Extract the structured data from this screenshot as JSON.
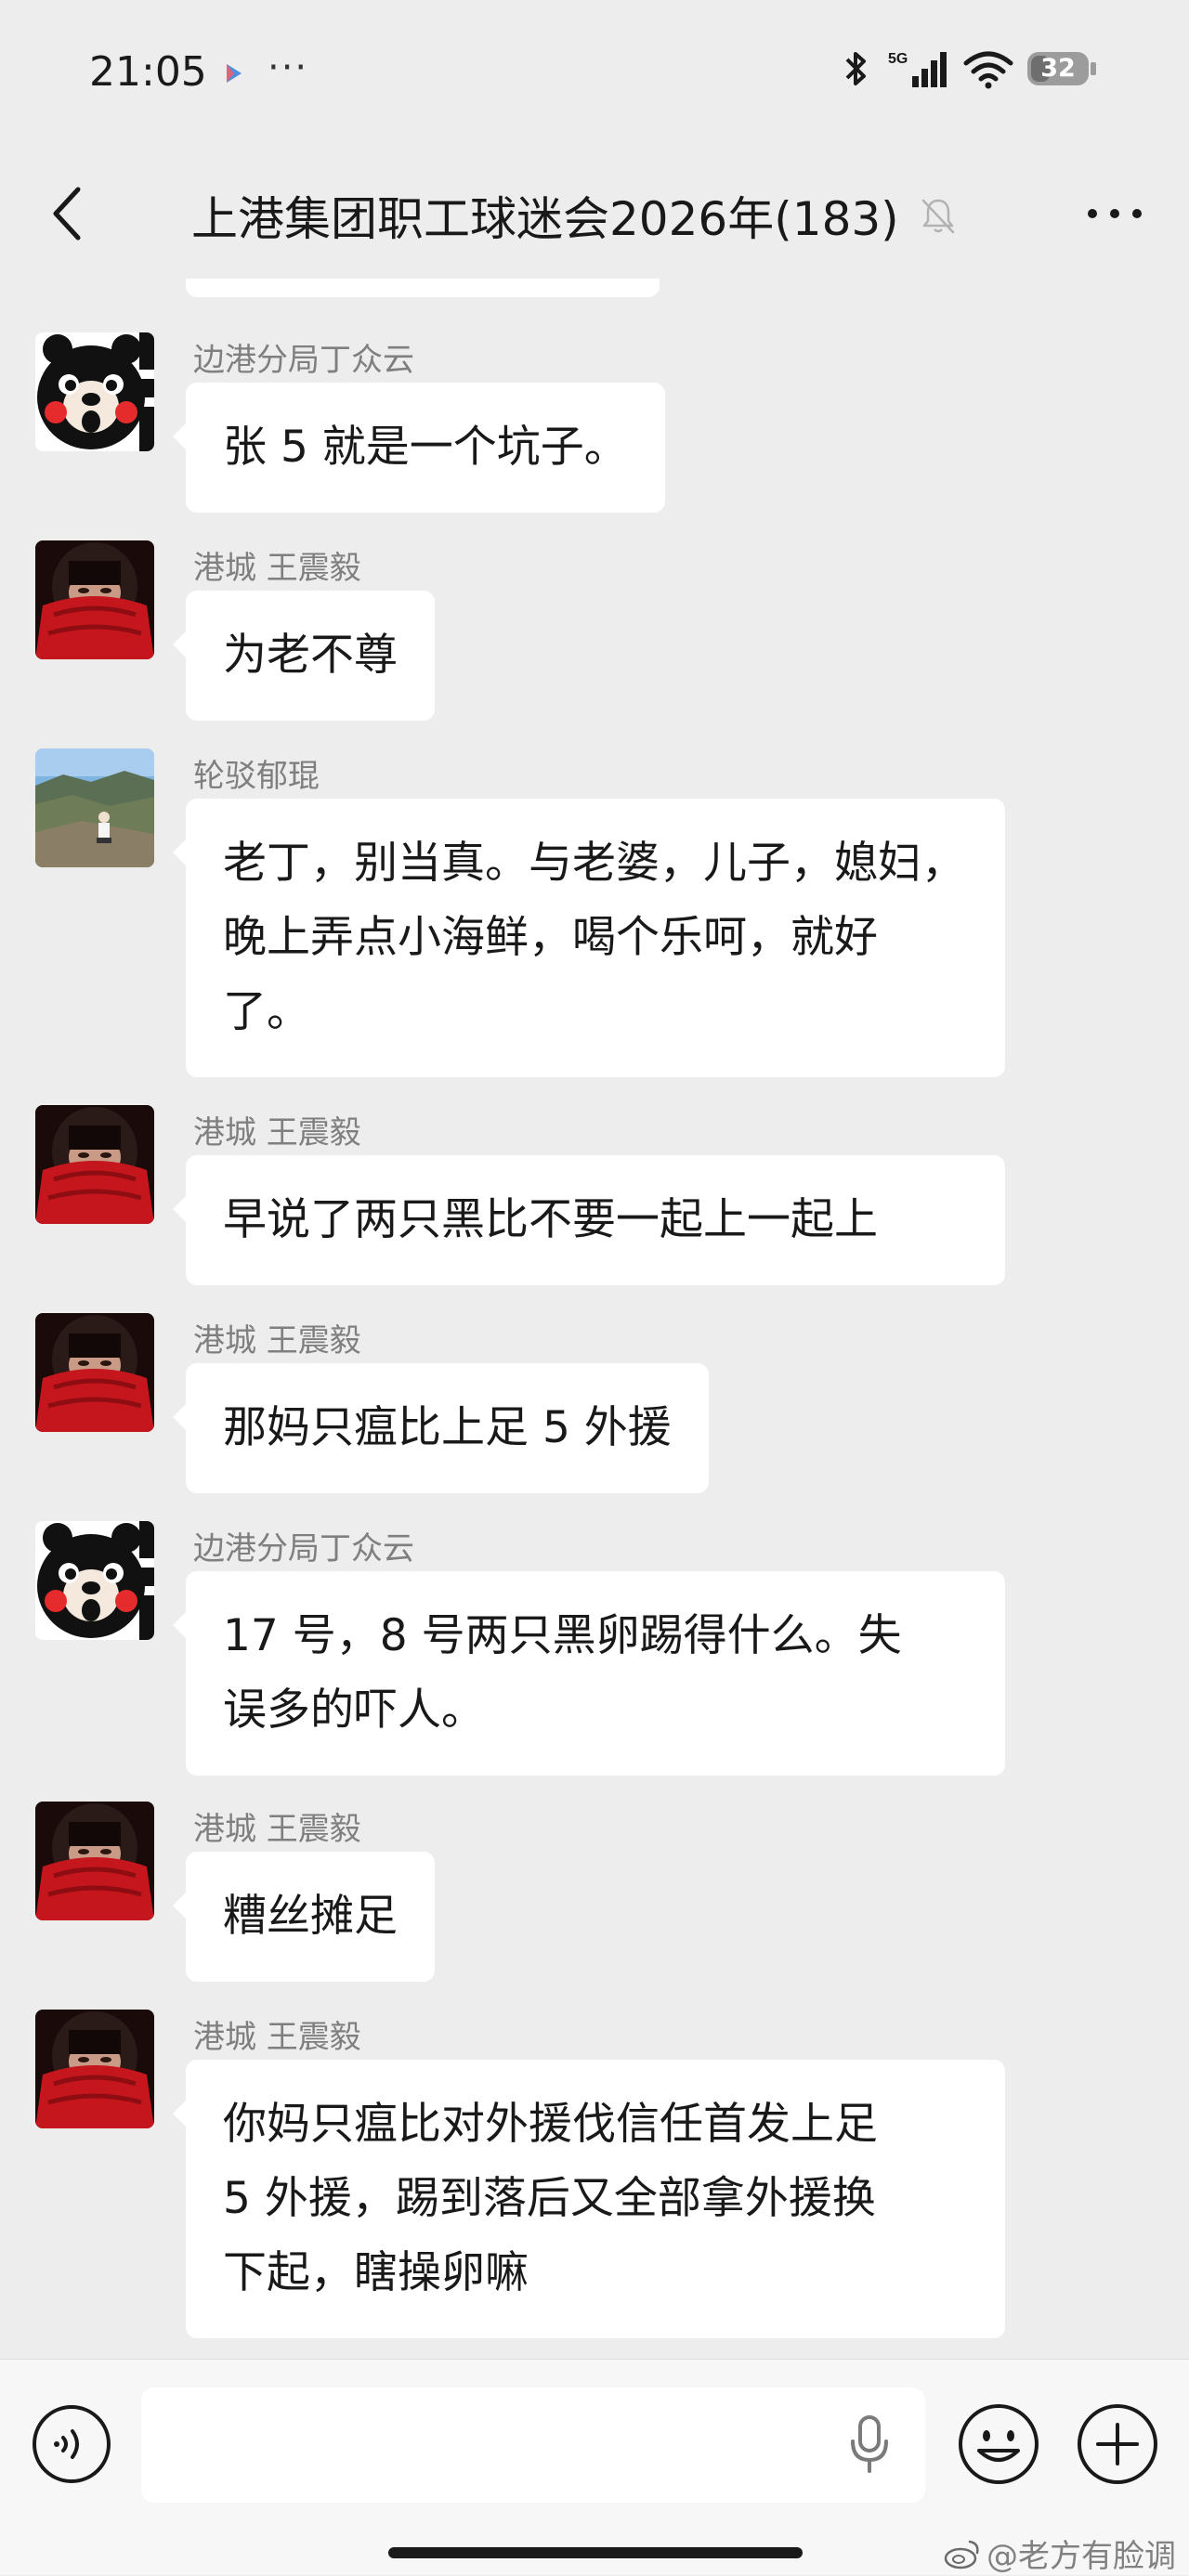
{
  "status_bar": {
    "time": "21:05",
    "more": "···",
    "network_label": "5G",
    "battery": "32"
  },
  "nav": {
    "title": "上港集团职工球迷会2026年(183)"
  },
  "messages": [
    {
      "sender": "边港分局丁众云",
      "avatar": "bear-avatar",
      "text": "张 5 就是一个坑子。"
    },
    {
      "sender": "港城 王震毅",
      "avatar": "red-scarf-avatar",
      "text": "为老不尊"
    },
    {
      "sender": "轮驳郁琨",
      "avatar": "mountain-photo-avatar",
      "lines": [
        "老丁，别当真。与老婆，儿子，媳妇，",
        "晚上弄点小海鲜，喝个乐呵，就好",
        "了。"
      ]
    },
    {
      "sender": "港城 王震毅",
      "avatar": "red-scarf-avatar",
      "text": "早说了两只黑比不要一起上一起上"
    },
    {
      "sender": "港城 王震毅",
      "avatar": "red-scarf-avatar",
      "text": "那妈只瘟比上足 5 外援"
    },
    {
      "sender": "边港分局丁众云",
      "avatar": "bear-avatar",
      "lines": [
        "17 号，8 号两只黑卵踢得什么。失",
        "误多的吓人。"
      ]
    },
    {
      "sender": "港城 王震毅",
      "avatar": "red-scarf-avatar",
      "text": "糟丝摊足"
    },
    {
      "sender": "港城 王震毅",
      "avatar": "red-scarf-avatar",
      "lines": [
        "你妈只瘟比对外援伐信任首发上足",
        "5 外援，踢到落后又全部拿外援换",
        "下起，瞎操卵嘛"
      ]
    }
  ],
  "input": {
    "value": "",
    "placeholder": ""
  },
  "watermark": "@老方有脸调",
  "colors": {
    "background": "#ededed",
    "bubble": "#ffffff",
    "sender": "#7f7f7f",
    "text": "#191919"
  }
}
